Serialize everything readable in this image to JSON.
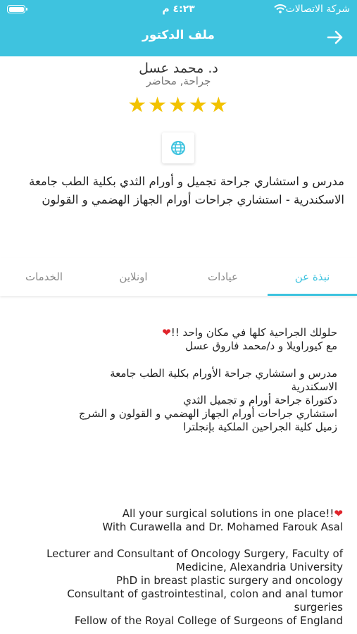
{
  "status_bar": {
    "carrier": "شركة الاتصالات",
    "time": "٤:٢٣ م"
  },
  "header": {
    "title": "ملف الدكتور"
  },
  "profile": {
    "name": "د. محمد عسل",
    "specialty": "جراحة, محاضر",
    "rating": 5,
    "stars": "★★★★★",
    "bio_line1": "مدرس و استشاري جراحة تجميل و أورام الثدي بكلية الطب جامعة",
    "bio_line2": "الاسكندرية - استشاري جراحات أورام الجهاز الهضمي و القولون"
  },
  "tabs": [
    {
      "label": "نبذة عن"
    },
    {
      "label": "عيادات"
    },
    {
      "label": "اونلاين"
    },
    {
      "label": "الخدمات"
    }
  ],
  "about": {
    "ar_line1": "حلولك الجراحية كلها في مكان واحد !!",
    "ar_line2": "مع كيوراويلا و د/محمد فاروق عسل",
    "ar_line3": "مدرس و استشاري جراحة الأورام بكلية الطب جامعة",
    "ar_line4": "الاسكندرية",
    "ar_line5": "دكتوراة جراحة أورام و تجميل الثدي",
    "ar_line6": "استشاري جراحات أورام الجهاز الهضمي و القولون و الشرج",
    "ar_line7": "زميل كلية الجراحين الملكية بإنجلترا",
    "en_line1": "All your surgical solutions in one place!!",
    "en_line2": "With Curawella and Dr. Mohamed Farouk Asal",
    "en_line3": "Lecturer and Consultant of Oncology Surgery, Faculty of",
    "en_line4": "Medicine, Alexandria University",
    "en_line5": "PhD in breast plastic surgery and oncology",
    "en_line6": "Consultant of gastrointestinal, colon and anal tumor",
    "en_line7": "surgeries",
    "en_line8": "Fellow of the Royal College of Surgeons of England"
  },
  "colors": {
    "accent": "#3ec3df",
    "star": "#f2c200",
    "heart": "#e0242b"
  }
}
